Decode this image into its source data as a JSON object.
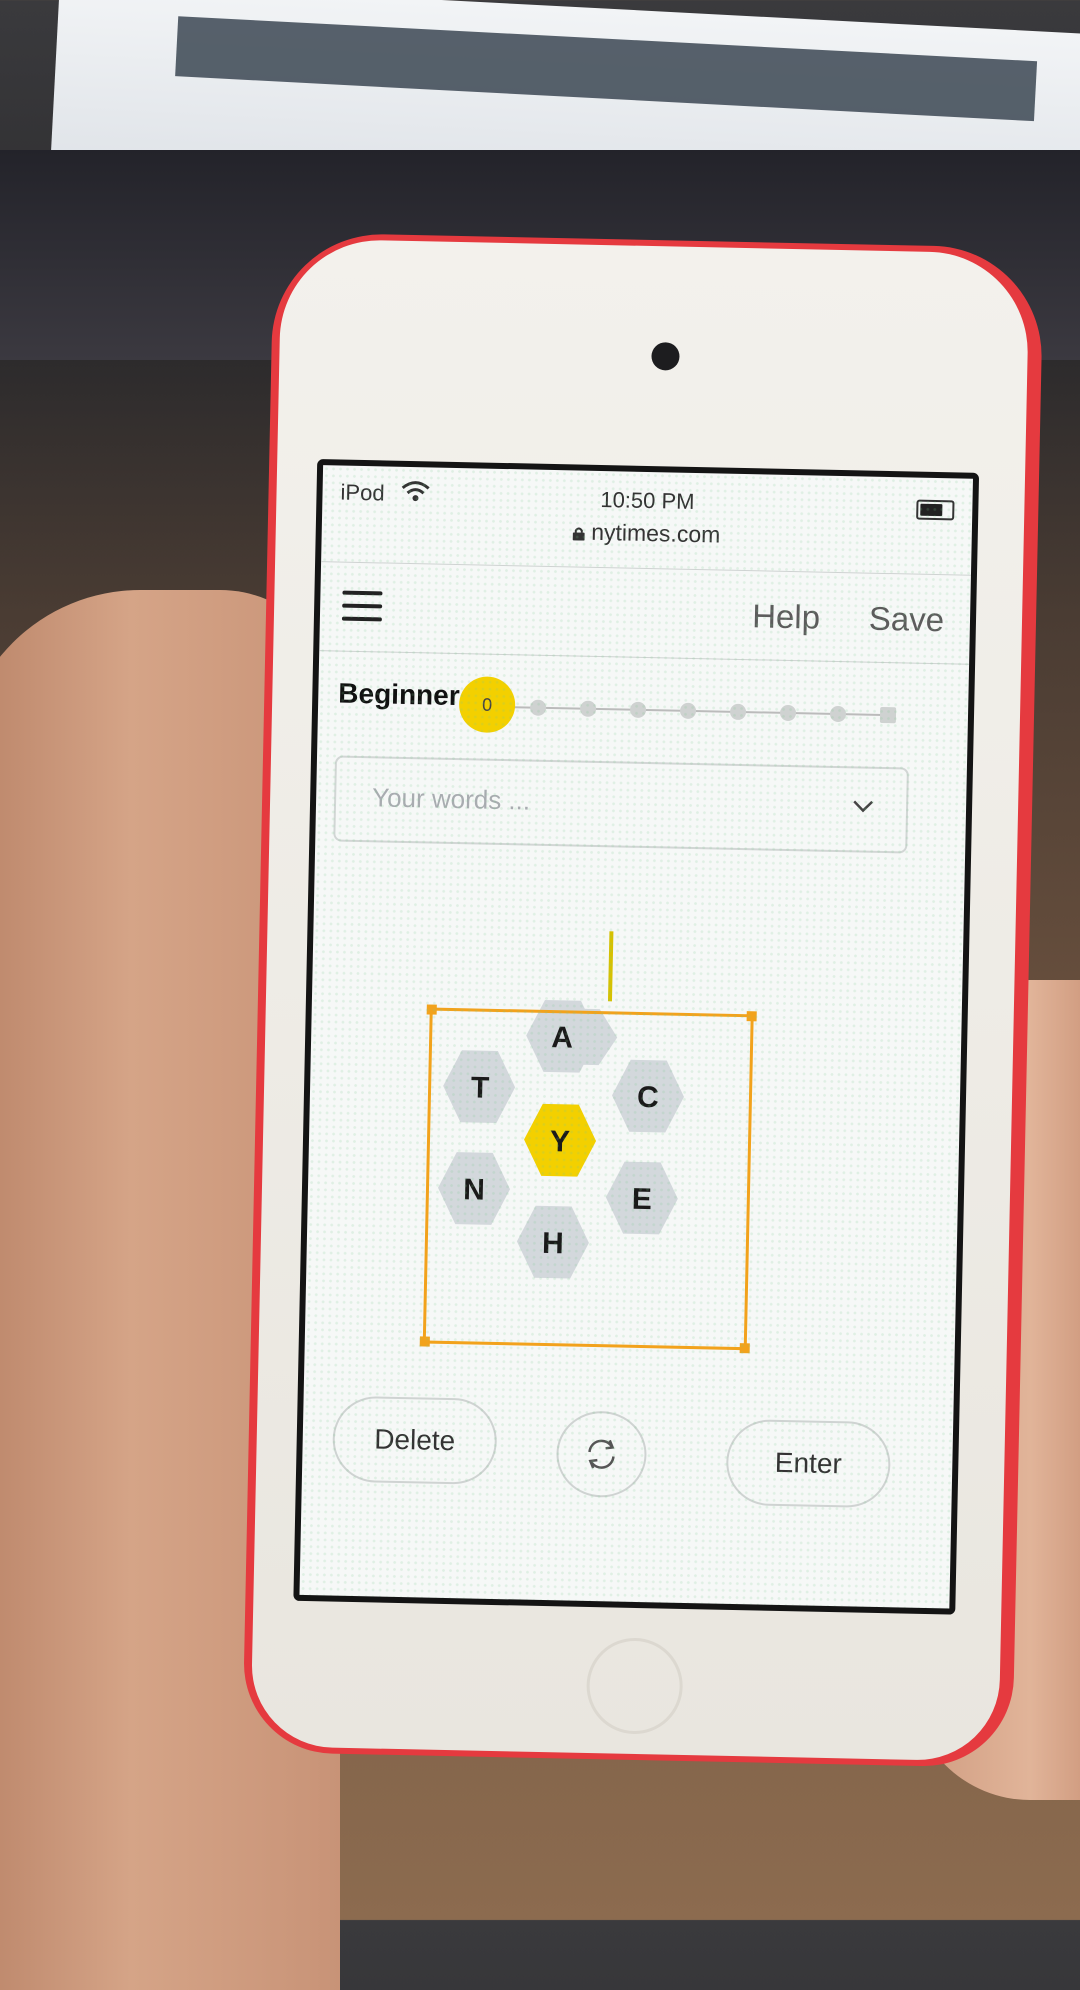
{
  "status_bar": {
    "device": "iPod",
    "time": "10:50 PM",
    "url": "nytimes.com",
    "icons": [
      "wifi-icon",
      "lock-icon",
      "battery-icon"
    ]
  },
  "nav": {
    "help_label": "Help",
    "save_label": "Save",
    "menu_icon": "hamburger-icon"
  },
  "rank": {
    "label": "Beginner",
    "score": "0",
    "level_count": 9,
    "current_level": 0
  },
  "words": {
    "placeholder": "Your words ..."
  },
  "hive": {
    "center": "Y",
    "outer": {
      "top": "A",
      "upper_left": "T",
      "upper_right": "C",
      "lower_left": "N",
      "lower_right": "E",
      "bottom": "H"
    },
    "colors": {
      "center": "#f3d000",
      "outer": "#d3d8dc"
    }
  },
  "controls": {
    "delete_label": "Delete",
    "shuffle_icon": "shuffle-icon",
    "enter_label": "Enter"
  },
  "colors": {
    "accent": "#f3d000",
    "selection": "#f2a21c",
    "device": "#e53a3f"
  }
}
